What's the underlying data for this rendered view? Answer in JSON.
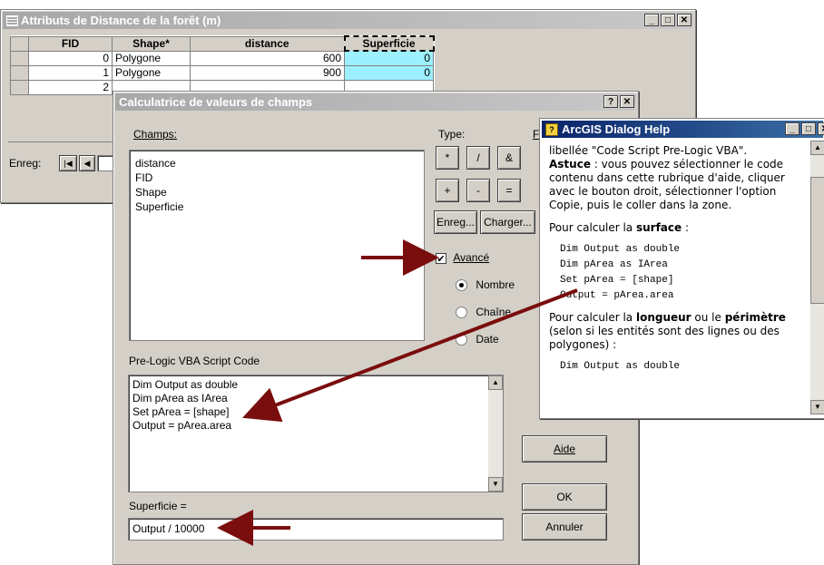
{
  "attr_window": {
    "title": "Attributs de  Distance de la forêt (m)",
    "columns": [
      "FID",
      "Shape*",
      "distance",
      "Superficie"
    ],
    "rows": [
      {
        "fid": "0",
        "shape": "Polygone",
        "distance": "600",
        "superficie": "0"
      },
      {
        "fid": "1",
        "shape": "Polygone",
        "distance": "900",
        "superficie": "0"
      },
      {
        "fid": "2",
        "shape": "",
        "distance": "",
        "superficie": ""
      }
    ],
    "record_label": "Enreg:"
  },
  "calc_dialog": {
    "title": "Calculatrice de valeurs de champs",
    "fields_label": "Champs:",
    "fields": [
      "distance",
      "FID",
      "Shape",
      "Superficie"
    ],
    "type_label": "Type:",
    "functions_label_partial": "F",
    "ops": [
      "*",
      "/",
      "&",
      "+",
      "-",
      "="
    ],
    "save_button": "Enreg...",
    "load_button": "Charger...",
    "advanced_label": "Avancé",
    "advanced_checked": "✔",
    "type_number": "Nombre",
    "type_string": "Chaîne",
    "type_date": "Date",
    "prelogic_label": "Pre-Logic VBA Script Code",
    "prelogic_lines": [
      "Dim Output as double",
      "Dim pArea as IArea",
      "Set pArea = [shape]",
      "Output = pArea.area"
    ],
    "result_label": "Superficie =",
    "result_value": "Output / 10000",
    "help_button": "Aide",
    "ok_button": "OK",
    "cancel_button": "Annuler"
  },
  "help_window": {
    "title": "ArcGIS Dialog Help",
    "para1": "libellée \"Code Script Pre-Logic VBA\".",
    "astuce_bold": "Astuce",
    "astuce_text": " : vous pouvez sélectionner le code contenu dans cette rubrique d'aide, cliquer avec le bouton droit, sélectionner l'option Copie, puis le coller dans la zone.",
    "surface_pre": "Pour calculer la ",
    "surface_bold": "surface",
    "surface_post": " :",
    "code1": [
      "Dim Output as double",
      "Dim pArea as IArea",
      "Set pArea = [shape]",
      "Output = pArea.area"
    ],
    "longueur_pre": "Pour calculer la ",
    "longueur_bold": "longueur",
    "longueur_mid": " ou le ",
    "perimetre_bold": "périmètre",
    "longueur_post": " (selon si les entités sont des lignes ou des polygones) :",
    "code2": [
      "Dim Output as double"
    ]
  },
  "colors": {
    "arrow": "#7a0d0d",
    "selected_cell": "#9cf0ff",
    "active_title": "#0a246a"
  }
}
